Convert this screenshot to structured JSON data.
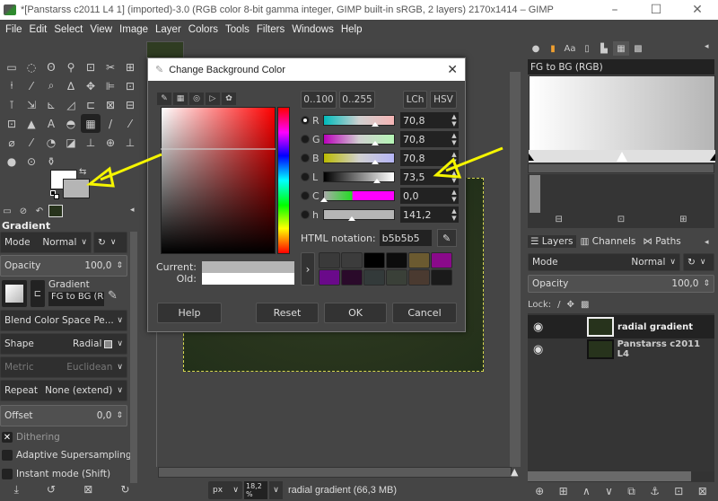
{
  "window": {
    "title": "*[Panstarss c2011 L4 1] (imported)-3.0 (RGB color 8-bit gamma integer, GIMP built-in sRGB, 2 layers) 2170x1414 – GIMP",
    "minimize": "–",
    "maximize": "☐",
    "close": "✕"
  },
  "menu": [
    "File",
    "Edit",
    "Select",
    "View",
    "Image",
    "Layer",
    "Colors",
    "Tools",
    "Filters",
    "Windows",
    "Help"
  ],
  "toolbox": {
    "tools": [
      "▭",
      "◌",
      "ʘ",
      "⚲",
      "⊡",
      "✂",
      "⊞",
      "⍿",
      "⁄",
      "⌕",
      "∆",
      "✥",
      "⊫",
      "⊡",
      "⊺",
      "⇲",
      "⊾",
      "◿",
      "⊏",
      "⊠",
      "⊟",
      "⊡",
      "▲",
      "A",
      "◓",
      "▦",
      "/",
      "⁄",
      "⌀",
      "⁄",
      "◔",
      "◪",
      "⊥",
      "⊕",
      "⊥",
      "●",
      "⊙",
      "⚱"
    ],
    "active_tool_index": 25,
    "fg_color": "#ffffff",
    "bg_color": "#b5b5b5",
    "swap_icon": "⇆"
  },
  "tool_options": {
    "title": "Gradient",
    "mode_label": "Mode",
    "mode_value": "Normal",
    "opacity_label": "Opacity",
    "opacity_value": "100,0",
    "gradient_label": "Gradient",
    "gradient_value": "FG to BG (R",
    "blend_space": "Blend Color Space Pe...",
    "shape_label": "Shape",
    "shape_value": "Radial",
    "metric_label": "Metric",
    "metric_value": "Euclidean",
    "repeat_label": "Repeat",
    "repeat_value": "None (extend)",
    "offset_label": "Offset",
    "offset_value": "0,0",
    "dithering": "Dithering",
    "dithering_checked": true,
    "adaptive": "Adaptive Supersampling",
    "adaptive_checked": false,
    "instant": "Instant mode  (Shift)",
    "instant_checked": false
  },
  "dialog": {
    "title": "Change Background Color",
    "range_100": "0..100",
    "range_255": "0..255",
    "lch": "LCh",
    "hsv": "HSV",
    "channels": [
      {
        "label": "R",
        "value": "70,8",
        "selected": true,
        "fraction": 0.708
      },
      {
        "label": "G",
        "value": "70,8",
        "selected": false,
        "fraction": 0.708
      },
      {
        "label": "B",
        "value": "70,8",
        "selected": false,
        "fraction": 0.708
      },
      {
        "label": "L",
        "value": "73,5",
        "selected": false,
        "fraction": 0.735
      },
      {
        "label": "C",
        "value": "0,0",
        "selected": false,
        "fraction": 0.0
      },
      {
        "label": "h",
        "value": "141,2",
        "selected": false,
        "fraction": 0.392
      }
    ],
    "html_label": "HTML notation:",
    "html_value": "b5b5b5",
    "history": [
      "#3a3a3a",
      "#3c3c3c",
      "#000000",
      "#0c0c0c",
      "#6b5a30",
      "#8a0a8a",
      "#6a0a8a",
      "#2a0a2a",
      "#333a3a",
      "#3a4038",
      "#4a3a30",
      "#1a1a1a"
    ],
    "current_label": "Current:",
    "old_label": "Old:",
    "current_color": "#b5b5b5",
    "old_color": "#ffffff",
    "help": "Help",
    "reset": "Reset",
    "ok": "OK",
    "cancel": "Cancel"
  },
  "statusbar": {
    "unit": "px",
    "zoom": "18,2 %",
    "message": "radial gradient (66,3 MB)"
  },
  "gradients": {
    "name": "FG to BG (RGB)"
  },
  "layers": {
    "tabs": [
      "Layers",
      "Channels",
      "Paths"
    ],
    "mode_label": "Mode",
    "mode_value": "Normal",
    "opacity_label": "Opacity",
    "opacity_value": "100,0",
    "lock_label": "Lock:",
    "items": [
      {
        "name": "radial gradient",
        "selected": true
      },
      {
        "name": "Panstarss c2011 L4",
        "selected": false
      }
    ]
  }
}
